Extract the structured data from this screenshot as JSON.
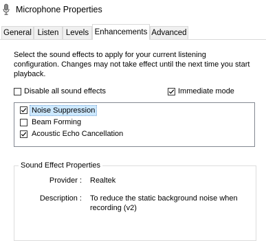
{
  "window": {
    "title": "Microphone Properties",
    "icon": "microphone-icon"
  },
  "tabs": [
    {
      "label": "General",
      "active": false
    },
    {
      "label": "Listen",
      "active": false
    },
    {
      "label": "Levels",
      "active": false
    },
    {
      "label": "Enhancements",
      "active": true
    },
    {
      "label": "Advanced",
      "active": false
    }
  ],
  "enhancements": {
    "description": "Select the sound effects to apply for your current listening\nconfiguration. Changes may not take effect until the next time you start\nplayback.",
    "disable_all": {
      "label": "Disable all sound effects",
      "checked": false
    },
    "immediate_mode": {
      "label": "Immediate mode",
      "checked": true
    },
    "effects": [
      {
        "label": "Noise Suppression",
        "checked": true,
        "selected": true
      },
      {
        "label": "Beam Forming",
        "checked": false,
        "selected": false
      },
      {
        "label": "Acoustic Echo Cancellation",
        "checked": true,
        "selected": false
      }
    ],
    "properties": {
      "title": "Sound Effect Properties",
      "provider_label": "Provider :",
      "provider_value": "Realtek",
      "description_label": "Description :",
      "description_value": "To reduce the static background noise when\nrecording (v2)"
    }
  },
  "colors": {
    "selection": "#cce8ff",
    "tab_inactive": "#f0f0f0",
    "border": "#d9d9d9"
  }
}
